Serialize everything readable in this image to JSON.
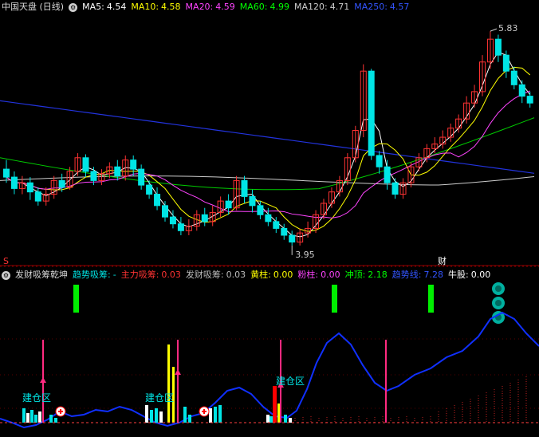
{
  "header": {
    "symbol": "中国天盘 (日线)",
    "ma_items": [
      {
        "label": "MA5:",
        "value": "4.54",
        "color": "#ffffff"
      },
      {
        "label": "MA10:",
        "value": "4.58",
        "color": "#ffff00"
      },
      {
        "label": "MA20:",
        "value": "4.59",
        "color": "#ff44ff"
      },
      {
        "label": "MA60:",
        "value": "4.99",
        "color": "#00ff00"
      },
      {
        "label": "MA120:",
        "value": "4.71",
        "color": "#cccccc"
      },
      {
        "label": "MA250:",
        "value": "4.57",
        "color": "#3355ff"
      }
    ]
  },
  "price_chart": {
    "high_label": "5.83",
    "low_label": "3.95",
    "marker_s": "S",
    "marker_cai": "财"
  },
  "indicator_header": {
    "name": "发财吸筹乾坤",
    "items": [
      {
        "label": "趋势吸筹:",
        "value": "-",
        "color": "#00e5e5"
      },
      {
        "label": "主力吸筹:",
        "value": "0.03",
        "color": "#ff3333"
      },
      {
        "label": "发财吸筹:",
        "value": "0.03",
        "color": "#bbbbbb"
      },
      {
        "label": "黄柱:",
        "value": "0.00",
        "color": "#ffff00"
      },
      {
        "label": "粉柱:",
        "value": "0.00",
        "color": "#ff44ff"
      },
      {
        "label": "冲顶:",
        "value": "2.18",
        "color": "#00ff00"
      },
      {
        "label": "趋势线:",
        "value": "7.28",
        "color": "#3355ff"
      },
      {
        "label": "牛股:",
        "value": "0.00",
        "color": "#ffffff"
      }
    ]
  },
  "indicator_chart": {
    "zone_label": "建仓区"
  },
  "colors": {
    "up": "#ff3333",
    "down": "#00e5e5",
    "ma250": "#2233dd",
    "ma120": "#cccccc",
    "ma60": "#00cc00"
  }
}
